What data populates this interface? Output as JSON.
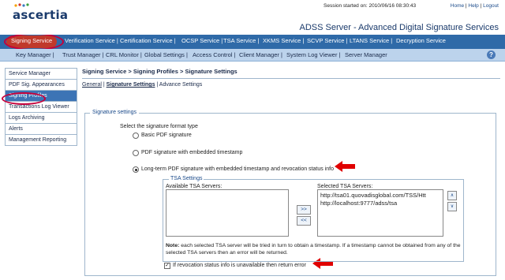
{
  "header": {
    "logo": "ascertia",
    "session": "Session started on: 2010/06/16 08:30:43",
    "links": [
      "Home",
      "Help",
      "Logout"
    ],
    "app_title": "ADSS Server - Advanced Digital Signature Services"
  },
  "nav_primary": [
    "Signing Service",
    "Verification Service",
    "Certification Service",
    "OCSP Service",
    "TSA Service",
    "XKMS Service",
    "SCVP Service",
    "LTANS Service",
    "Decryption Service"
  ],
  "nav_secondary": [
    "Key Manager",
    "Trust Manager",
    "CRL Monitor",
    "Global Settings",
    "Access Control",
    "Client Manager",
    "System Log Viewer",
    "Server Manager"
  ],
  "help_icon": "?",
  "sidebar": [
    "Service Manager",
    "PDF Sig. Appearances",
    "Signing Profiles",
    "Transactions Log Viewer",
    "Logs Archiving",
    "Alerts",
    "Management Reporting"
  ],
  "breadcrumb": "Signing Service > Signing Profiles > Signature Settings",
  "subtabs": {
    "general": "General",
    "signature_settings": "Signature Settings",
    "advance": "Advance Settings"
  },
  "signature_settings": {
    "legend": "Signature settings",
    "prompt": "Select the signature format type",
    "options": [
      "Basic PDF signature",
      "PDF signature with embedded timestamp",
      "Long-term PDF signature with embedded timestamp and revocation status info"
    ],
    "selected_option": 2
  },
  "tsa": {
    "legend": "TSA Settings",
    "available_label": "Available TSA Servers:",
    "selected_label": "Selected TSA Servers:",
    "selected": [
      "http://tsa01.quovadisglobal.com/TSS/Htt",
      "http://localhost:9777/adss/tsa"
    ],
    "add_button": ">>",
    "remove_button": "<<",
    "up_button": "∧",
    "down_button": "∨",
    "note_bold": "Note:",
    "note": " each selected TSA server will be tried in turn to obtain a timestamp. If a timestamp cannot be obtained from any of the selected TSA servers then an error will be returned."
  },
  "revocation_checkbox": {
    "label": "If revocation status info is unavailable then return error",
    "checked": true
  },
  "colors": {
    "nav_primary_bg": "#2f6aa8",
    "nav_secondary_bg": "#bcd3ec",
    "highlight": "#c5003a",
    "active_sidebar": "#3c74b5"
  }
}
